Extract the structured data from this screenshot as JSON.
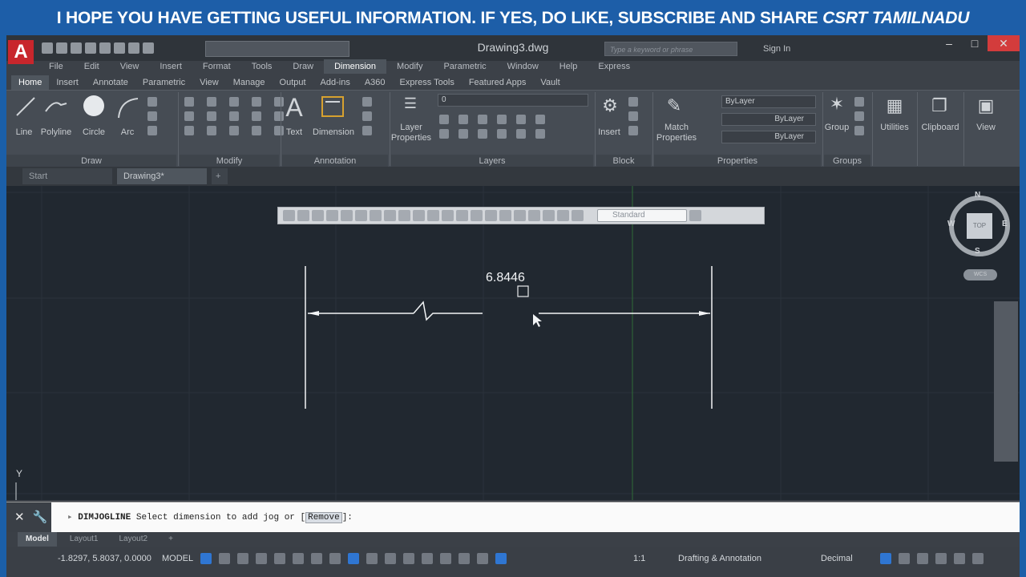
{
  "banner": {
    "text": "I HOPE YOU HAVE GETTING USEFUL INFORMATION. IF YES, DO LIKE, SUBSCRIBE AND SHARE",
    "brand": "CSRT TAMILNADU"
  },
  "app": {
    "logo": "A",
    "document_title": "Drawing3.dwg",
    "search_placeholder": "Type a keyword or phrase",
    "sign_in": "Sign In"
  },
  "menu": [
    "File",
    "Edit",
    "View",
    "Insert",
    "Format",
    "Tools",
    "Draw",
    "Dimension",
    "Modify",
    "Parametric",
    "Window",
    "Help",
    "Express"
  ],
  "menu_active": "Dimension",
  "ribbon_tabs": [
    "Home",
    "Insert",
    "Annotate",
    "Parametric",
    "View",
    "Manage",
    "Output",
    "Add-ins",
    "A360",
    "Express Tools",
    "Featured Apps",
    "Vault"
  ],
  "ribbon_active": "Home",
  "ribbon": {
    "draw": {
      "line": "Line",
      "polyline": "Polyline",
      "circle": "Circle",
      "arc": "Arc",
      "header": "Draw"
    },
    "modify": {
      "header": "Modify"
    },
    "annotation": {
      "text": "Text",
      "dimension": "Dimension",
      "header": "Annotation"
    },
    "layers": {
      "layer_properties": "Layer Properties",
      "current_layer": "0",
      "header": "Layers"
    },
    "block": {
      "insert": "Insert",
      "header": "Block"
    },
    "properties": {
      "match": "Match Properties",
      "color": "ByLayer",
      "linetype": "ByLayer",
      "lineweight": "ByLayer",
      "header": "Properties"
    },
    "groups": {
      "group": "Group",
      "header": "Groups"
    },
    "utilities": "Utilities",
    "clipboard": "Clipboard",
    "view": "View"
  },
  "doc_tabs": [
    "Start",
    "Drawing3*"
  ],
  "doc_tab_active": "Drawing3*",
  "dimension_toolbar": {
    "style": "Standard"
  },
  "drawing": {
    "dimension_text": "6.8446"
  },
  "viewcube": {
    "n": "N",
    "s": "S",
    "e": "E",
    "w": "W",
    "face": "TOP",
    "wcs": "WCS"
  },
  "ucs_y": "Y",
  "command_line": {
    "command": "DIMJOGLINE",
    "prompt": "Select dimension to add jog or [",
    "option": "Remove",
    "suffix": "]:"
  },
  "layout_tabs": [
    "Model",
    "Layout1",
    "Layout2"
  ],
  "layout_active": "Model",
  "status_bar": {
    "coordinates": "-1.8297, 5.8037, 0.0000",
    "space": "MODEL",
    "scale": "1:1",
    "workspace": "Drafting & Annotation",
    "units": "Decimal"
  },
  "colors": {
    "accent": "#2f76d2",
    "close": "#d33c3c",
    "canvas": "#212830"
  }
}
